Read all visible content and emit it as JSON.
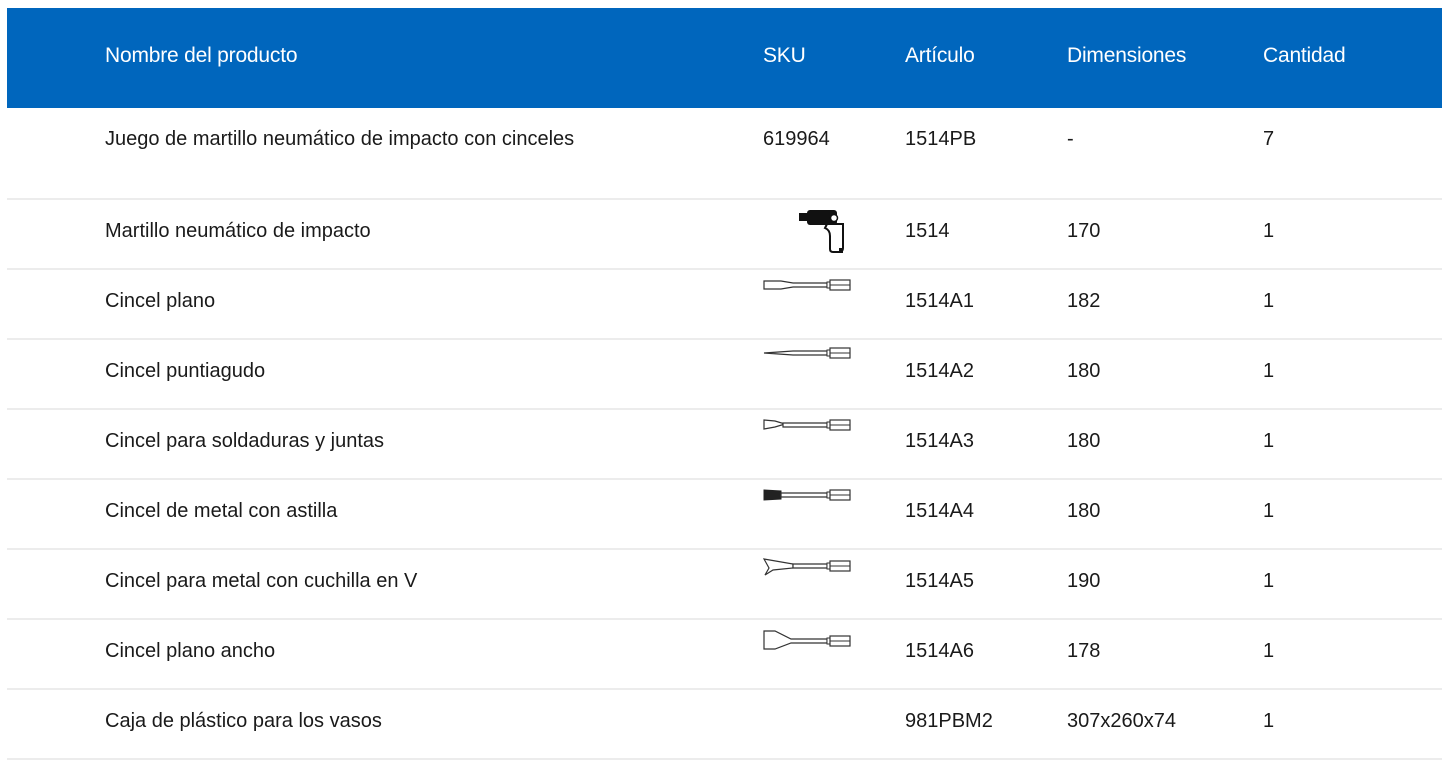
{
  "header": {
    "name": "Nombre del producto",
    "sku": "SKU",
    "article": "Artículo",
    "dimensions": "Dimensiones",
    "quantity": "Cantidad"
  },
  "colors": {
    "header_bg": "#0066bd",
    "header_text": "#ffffff",
    "divider": "#ececec"
  },
  "rows": [
    {
      "name": "Juego de martillo neumático de impacto con cinceles",
      "sku": "619964",
      "article": "1514PB",
      "dimensions": "-",
      "quantity": "7",
      "icon": ""
    },
    {
      "name": "Martillo neumático de impacto",
      "sku": "",
      "article": "1514",
      "dimensions": "170",
      "quantity": "1",
      "icon": "air-hammer-icon"
    },
    {
      "name": "Cincel plano",
      "sku": "",
      "article": "1514A1",
      "dimensions": "182",
      "quantity": "1",
      "icon": "flat-chisel-icon"
    },
    {
      "name": "Cincel puntiagudo",
      "sku": "",
      "article": "1514A2",
      "dimensions": "180",
      "quantity": "1",
      "icon": "pointed-chisel-icon"
    },
    {
      "name": "Cincel para soldaduras y juntas",
      "sku": "",
      "article": "1514A3",
      "dimensions": "180",
      "quantity": "1",
      "icon": "weld-chisel-icon"
    },
    {
      "name": "Cincel de metal con astilla",
      "sku": "",
      "article": "1514A4",
      "dimensions": "180",
      "quantity": "1",
      "icon": "splitter-chisel-icon"
    },
    {
      "name": "Cincel para metal con cuchilla en V",
      "sku": "",
      "article": "1514A5",
      "dimensions": "190",
      "quantity": "1",
      "icon": "v-blade-chisel-icon"
    },
    {
      "name": "Cincel plano ancho",
      "sku": "",
      "article": "1514A6",
      "dimensions": "178",
      "quantity": "1",
      "icon": "wide-flat-chisel-icon"
    },
    {
      "name": "Caja de plástico para los vasos",
      "sku": "",
      "article": "981PBM2",
      "dimensions": "307x260x74",
      "quantity": "1",
      "icon": ""
    }
  ]
}
